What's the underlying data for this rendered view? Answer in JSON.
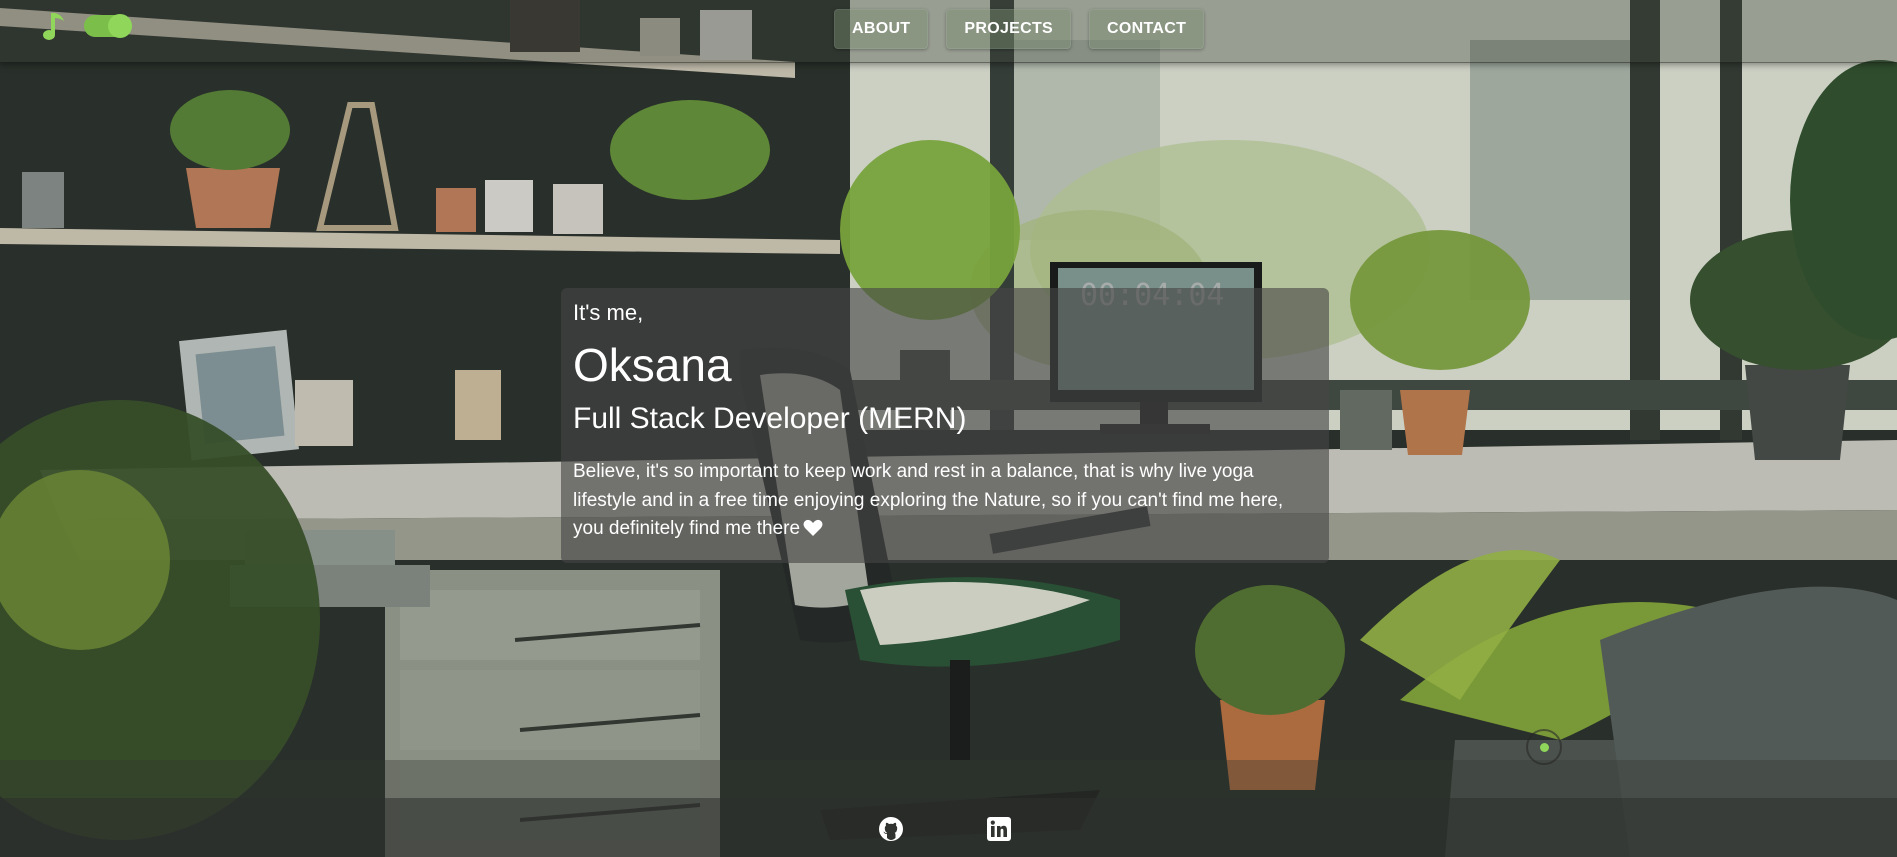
{
  "theme": {
    "accent": "#8fd65a",
    "text": "#ffffff",
    "card_bg": "#464646"
  },
  "topbar": {
    "music_icon": "music-note-icon",
    "toggle_state": "on"
  },
  "nav": {
    "items": [
      {
        "label": "ABOUT"
      },
      {
        "label": "PROJECTS"
      },
      {
        "label": "CONTACT"
      }
    ]
  },
  "intro": {
    "greeting": "It's me,",
    "name": "Oksana",
    "role": "Full Stack Developer (MERN)",
    "bio": "Believe, it's so important to keep work and rest in a balance, that is why live yoga lifestyle and in a free time enjoying exploring the Nature, so if you can't find me here, you definitely find me there",
    "bio_emoji": "white-heart-icon"
  },
  "background": {
    "monitor_clock": "00:04:04"
  },
  "footer": {
    "links": [
      {
        "icon": "github-icon"
      },
      {
        "icon": "linkedin-icon"
      }
    ]
  }
}
